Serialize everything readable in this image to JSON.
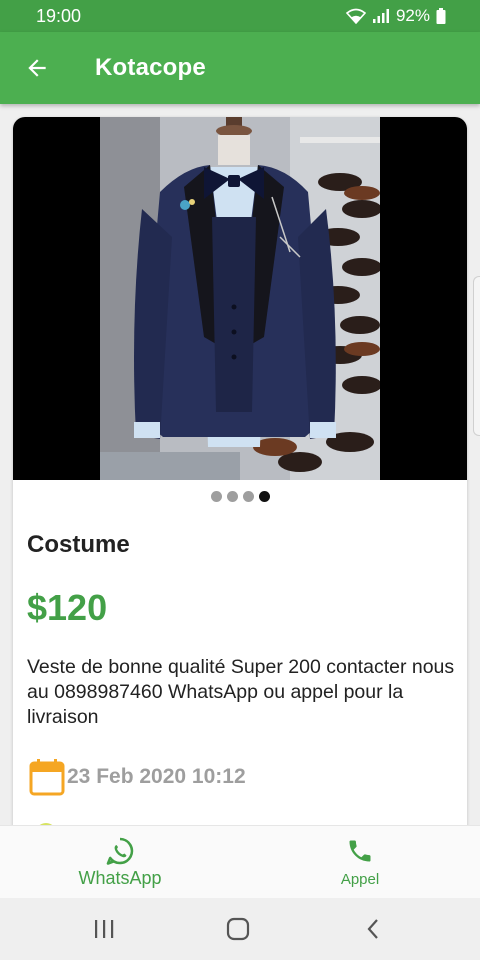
{
  "status_bar": {
    "time": "19:00",
    "battery": "92%"
  },
  "app_bar": {
    "title": "Kotacope",
    "back_icon": "arrow-left-icon"
  },
  "product": {
    "image_count": 4,
    "active_image_index": 3,
    "name": "Costume",
    "price": "$120",
    "description": "Veste de bonne qualité Super 200 contacter nous au 0898987460 WhatsApp ou appel pour la livraison",
    "date": "23 Feb 2020 10:12",
    "date_icon": "calendar-icon"
  },
  "actions": {
    "whatsapp_label": "WhatsApp",
    "call_label": "Appel"
  },
  "colors": {
    "primary": "#4caf50",
    "price": "#43a047",
    "calendar": "#f5a623",
    "date_text": "#9e9e9e"
  }
}
